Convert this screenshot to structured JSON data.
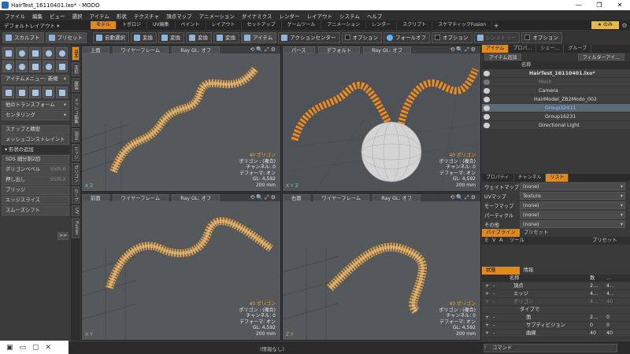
{
  "window": {
    "title": "HairTest_16110401.lxo* - MODO",
    "min": "—",
    "max": "❐",
    "close": "✕"
  },
  "menu": [
    "ファイル",
    "編集",
    "ビュー",
    "選択",
    "アイテム",
    "形状",
    "テクスチャ",
    "頂点マップ",
    "アニメーション",
    "ダイナミクス",
    "レンダー",
    "レイアウト",
    "システム",
    "ヘルプ"
  ],
  "layoutbar": {
    "layout_label": "デフォルトレイアウト ▾",
    "tabs": [
      "モデル",
      "トポロジ",
      "UV編集",
      "ペイント",
      "レイアウト",
      "セットアップ",
      "ゲームツール",
      "アニメーション",
      "レンダー",
      "スクリプト",
      "スケマティックFusion"
    ],
    "active_tab": "モデル",
    "plus": "+",
    "nomi": "★ のみ"
  },
  "toolbar": {
    "sculpt": "スカルプト",
    "preset": "プリセット",
    "auto_select": "自動選択",
    "transform1": "変換",
    "transform2": "変換",
    "transform3": "変換",
    "transform4": "変換",
    "item": "アイテム",
    "action_center": "アクションセンター",
    "option1": "オプション",
    "falloff": "フォールオフ",
    "option2": "オプション",
    "symmetry": "シンメトリー",
    "option3": "オプション"
  },
  "leftpanel": {
    "item_menu": "アイテムメニュー: 新規",
    "transform_other": "他のトランスフォーム",
    "centering": "センタリング",
    "snap": "スナップと精密",
    "mesh_constraint": "メッシュコンストレイント",
    "shape_add": "▾ 形状の追加",
    "sds": "SDS 細分割2回",
    "polygon_bevel": "ポリゴンベベル",
    "polygon_bevel_sc": "Shift-B",
    "extrude": "押し出し",
    "extrude_sc": "Shift-X",
    "bridge": "ブリッジ",
    "edge_slice": "エッジスライス",
    "smooth_shift": "スムーズシフト",
    "more": ">>",
    "vtabs": [
      "基本",
      "変形",
      "複製",
      "メッシュ編集",
      "頂点",
      "エッジ",
      "ポリゴン",
      "カーブ",
      "UV",
      "Fusion"
    ]
  },
  "viewports": [
    {
      "name": "上面",
      "mode": "ワイヤーフレーム",
      "gl": "Ray GL: オフ",
      "poly": "40 ポリゴン",
      "polyinfo": "ポリゴン : (複合)",
      "channel": "チャンネル: 0",
      "deform": "デフォーマ: オン",
      "glcount": "GL: 4,592",
      "size": "200 mm",
      "axis": "X  Z"
    },
    {
      "name": "パース",
      "mode": "デフォルト",
      "gl": "Ray GL: オフ",
      "poly": "40 ポリゴン",
      "polyinfo": "ポリゴン : (複合)",
      "channel": "チャンネル: 0",
      "deform": "デフォーマ: オン",
      "glcount": "GL: 4,592",
      "size": "200 mm",
      "axis": "X Y Z"
    },
    {
      "name": "前面",
      "mode": "ワイヤーフレーム",
      "gl": "Ray GL: オフ",
      "poly": "40 ポリゴン",
      "polyinfo": "ポリゴン : (複合)",
      "channel": "チャンネル: 0",
      "deform": "デフォーマ: オン",
      "glcount": "GL: 4,592",
      "size": "200 mm",
      "axis": "X  Y"
    },
    {
      "name": "右面",
      "mode": "ワイヤーフレーム",
      "gl": "Ray GL: オフ",
      "poly": "40 ポリゴン",
      "polyinfo": "ポリゴン : (複合)",
      "channel": "チャンネル: 0",
      "deform": "デフォーマ: オン",
      "glcount": "GL: 4,592",
      "size": "200 mm",
      "axis": "Z  Y"
    }
  ],
  "rightpanel": {
    "tabs": [
      "アイテム",
      "プロパ…",
      "シェー…",
      "グループ"
    ],
    "add_item": "アイテム追加",
    "filter": "フィルターアイ…",
    "name_header": "名称",
    "items": [
      {
        "label": "HairTest_16110401.lxo*",
        "cls": "",
        "bold": true
      },
      {
        "label": "Mesh",
        "cls": "dim"
      },
      {
        "label": "Camera",
        "cls": ""
      },
      {
        "label": "HairModel_ZB2Modo_002",
        "cls": ""
      },
      {
        "label": "Group32411",
        "cls": "hl"
      },
      {
        "label": "Group16231",
        "cls": ""
      },
      {
        "label": "Directional Light",
        "cls": ""
      }
    ],
    "lower_tabs": [
      "プロパティ",
      "チャンネル",
      "リスト"
    ],
    "list_rows": [
      {
        "k": "ウェイトマップ",
        "v": "(none)"
      },
      {
        "k": "UVマップ",
        "v": "Texture"
      },
      {
        "k": "モーフマップ",
        "v": "(none)"
      },
      {
        "k": "パーティクル",
        "v": "(none)"
      },
      {
        "k": "その他",
        "v": "(none)"
      }
    ],
    "pipeline_tabs": [
      "パイプライン",
      "プリセット"
    ],
    "edit_header": {
      "e": "E",
      "v": "V",
      "a": "A",
      "tool": "ツール",
      "preset": "プリセット"
    },
    "stat_tabs": [
      "状態",
      "情報"
    ],
    "stat_header": {
      "name": "名称",
      "num": "数",
      "sel": "…"
    },
    "stat_rows": [
      {
        "a": "+",
        "b": "-",
        "name": "頂点",
        "n": "2…",
        "s": "4…"
      },
      {
        "a": "+",
        "b": "-",
        "name": "エッジ",
        "n": "4…",
        "s": "4…"
      },
      {
        "a": "+",
        "b": "-",
        "name": "ポリゴン",
        "n": "4…",
        "s": "40"
      },
      {
        "a": "",
        "b": "",
        "name": "タイプで",
        "n": "",
        "s": ""
      },
      {
        "a": "+",
        "b": "-",
        "name": "面",
        "n": "2…",
        "s": "0"
      },
      {
        "a": "+",
        "b": "-",
        "name": "サブディビジョン",
        "n": "0",
        "s": "0"
      },
      {
        "a": "+",
        "b": "-",
        "name": "曲線",
        "n": "40",
        "s": "40"
      }
    ]
  },
  "status": {
    "info": "(情報なし)",
    "command": "コマンド"
  }
}
